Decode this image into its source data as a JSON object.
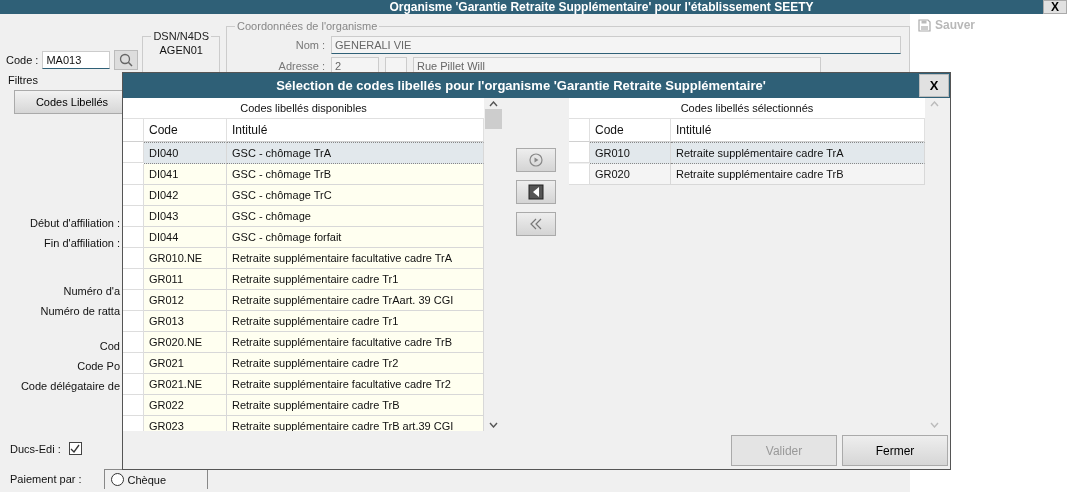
{
  "window": {
    "title": "Organisme 'Garantie Retraite Supplémentaire' pour l'établissement SEETY",
    "close": "X",
    "save_button": {
      "label": "Sauver",
      "disabled": true
    }
  },
  "form": {
    "code_label": "Code :",
    "code_value": "MA013",
    "dsn_legend": "DSN/N4DS",
    "dsn_value": "AGEN01",
    "contact_legend": "Coordonnées de l'organisme",
    "name_label": "Nom :",
    "name_value": "GENERALI VIE",
    "address_label": "Adresse :",
    "address_number": "2",
    "address_street": "Rue Pillet Will",
    "filters_label": "Filtres",
    "filter_button": "Codes Libellés",
    "labels": [
      "Début d'affiliation :",
      "Fin d'affiliation :"
    ],
    "cut_labels": [
      "Numéro d'a",
      "Numéro de ratta",
      "Cod",
      "Code Po",
      "Code délégataire de"
    ],
    "ducs_label": "Ducs-Edi :",
    "ducs_checked": true,
    "payment_label": "Paiement par :",
    "payment_option": {
      "label": "Chèque",
      "selected": false
    }
  },
  "dialog": {
    "title": "Sélection de codes libellés pour l'organisme 'Garantie Retraite Supplémentaire'",
    "close": "X",
    "available": {
      "heading": "Codes libellés disponibles",
      "columns": [
        "Code",
        "Intitulé"
      ],
      "rows": [
        {
          "code": "DI040",
          "label": "GSC - chômage TrA",
          "selected": true
        },
        {
          "code": "DI041",
          "label": "GSC - chômage TrB",
          "selected": false
        },
        {
          "code": "DI042",
          "label": "GSC - chômage TrC",
          "selected": false
        },
        {
          "code": "DI043",
          "label": "GSC - chômage",
          "selected": false
        },
        {
          "code": "DI044",
          "label": "GSC - chômage forfait",
          "selected": false
        },
        {
          "code": "GR010.NE",
          "label": "Retraite supplémentaire facultative cadre TrA",
          "selected": false
        },
        {
          "code": "GR011",
          "label": "Retraite supplémentaire cadre Tr1",
          "selected": false
        },
        {
          "code": "GR012",
          "label": "Retraite supplémentaire cadre TrAart. 39 CGI",
          "selected": false
        },
        {
          "code": "GR013",
          "label": "Retraite supplémentaire cadre Tr1",
          "selected": false
        },
        {
          "code": "GR020.NE",
          "label": "Retraite supplémentaire facultative cadre TrB",
          "selected": false
        },
        {
          "code": "GR021",
          "label": "Retraite supplémentaire cadre Tr2",
          "selected": false
        },
        {
          "code": "GR021.NE",
          "label": "Retraite supplémentaire facultative cadre Tr2",
          "selected": false
        },
        {
          "code": "GR022",
          "label": "Retraite supplémentaire cadre TrB",
          "selected": false
        },
        {
          "code": "GR023",
          "label": "Retraite supplémentaire cadre TrB art.39 CGI",
          "selected": false
        }
      ]
    },
    "chosen": {
      "heading": "Codes libellés sélectionnés",
      "columns": [
        "Code",
        "Intitulé"
      ],
      "rows": [
        {
          "code": "GR010",
          "label": "Retraite supplémentaire cadre TrA",
          "selected": true
        },
        {
          "code": "GR020",
          "label": "Retraite supplémentaire cadre TrB",
          "selected": false
        }
      ]
    },
    "transfer_buttons": [
      {
        "kind": "add"
      },
      {
        "kind": "remove"
      },
      {
        "kind": "remove_all"
      }
    ],
    "buttons": [
      {
        "label": "Valider",
        "disabled": true
      },
      {
        "label": "Fermer",
        "disabled": false
      }
    ]
  }
}
